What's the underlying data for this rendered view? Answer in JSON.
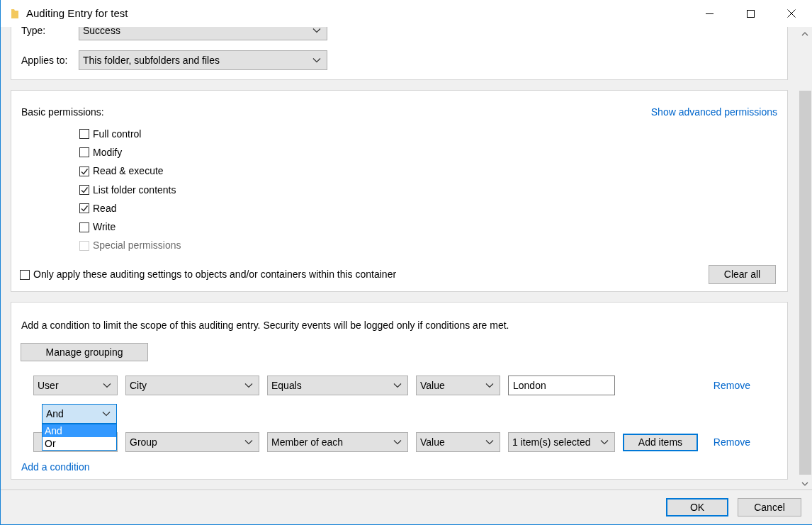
{
  "window": {
    "title": "Auditing Entry for test"
  },
  "principal_section": {
    "fields": [
      {
        "label": "Type:",
        "value": "Success"
      },
      {
        "label": "Applies to:",
        "value": "This folder, subfolders and files"
      }
    ]
  },
  "permissions": {
    "heading": "Basic permissions:",
    "advanced_link": "Show advanced permissions",
    "items": [
      {
        "label": "Full control",
        "checked": false,
        "disabled": false
      },
      {
        "label": "Modify",
        "checked": false,
        "disabled": false
      },
      {
        "label": "Read & execute",
        "checked": true,
        "disabled": false
      },
      {
        "label": "List folder contents",
        "checked": true,
        "disabled": false
      },
      {
        "label": "Read",
        "checked": true,
        "disabled": false
      },
      {
        "label": "Write",
        "checked": false,
        "disabled": false
      },
      {
        "label": "Special permissions",
        "checked": false,
        "disabled": true
      }
    ],
    "only_apply": {
      "label": "Only apply these auditing settings to objects and/or containers within this container",
      "checked": false
    },
    "clear_button": "Clear all"
  },
  "conditions": {
    "description": "Add a condition to limit the scope of this auditing entry. Security events will be logged only if conditions are met.",
    "manage_button": "Manage grouping",
    "rows": [
      {
        "fields": [
          {
            "kind": "combo",
            "value": "User"
          },
          {
            "kind": "combo",
            "value": "City"
          },
          {
            "kind": "combo",
            "value": "Equals"
          },
          {
            "kind": "combo",
            "value": "Value"
          },
          {
            "kind": "text",
            "value": "London"
          }
        ],
        "remove": "Remove"
      },
      {
        "fields": [
          {
            "kind": "combo"
          },
          {
            "kind": "combo",
            "value": "Group"
          },
          {
            "kind": "combo",
            "value": "Member of each"
          },
          {
            "kind": "combo",
            "value": "Value"
          },
          {
            "kind": "combo",
            "value": "1 item(s) selected"
          },
          {
            "kind": "button",
            "value": "Add items",
            "focused": true
          }
        ],
        "remove": "Remove"
      }
    ],
    "connector": {
      "value": "And",
      "open": true,
      "options": [
        {
          "label": "And",
          "selected": true
        },
        {
          "label": "Or",
          "selected": false
        }
      ]
    },
    "add_link": "Add a condition"
  },
  "buttons": [
    {
      "label": "OK",
      "default": true
    },
    {
      "label": "Cancel",
      "default": false
    }
  ]
}
